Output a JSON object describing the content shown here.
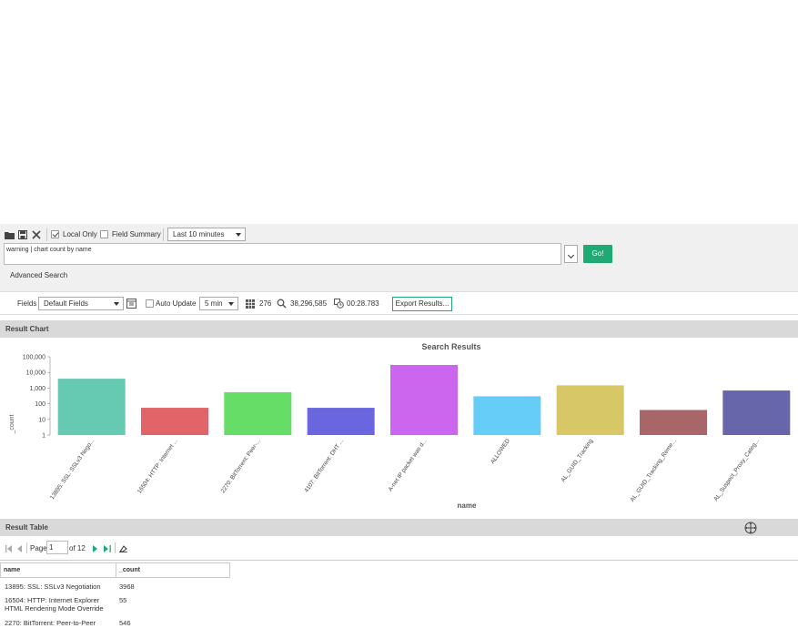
{
  "toolbar": {
    "local_only_label": "Local Only",
    "local_only_checked": true,
    "field_summary_label": "Field Summary",
    "field_summary_checked": false,
    "time_range": "Last 10 minutes"
  },
  "query": {
    "text": "warning | chart count by name",
    "go_label": "Go!",
    "advanced_label": "Advanced Search"
  },
  "fields_row": {
    "fields_label": "Fields",
    "fields_value": "Default Fields",
    "auto_update_label": "Auto Update",
    "auto_update_value": "5 min",
    "result_count": "276",
    "scanned_count": "38,296,585",
    "elapsed": "00:28.783",
    "export_label": "Export Results..."
  },
  "result_chart": {
    "section_title": "Result Chart"
  },
  "chart_data": {
    "type": "bar",
    "title": "Search Results",
    "xlabel": "name",
    "ylabel": "_count",
    "yscale": "log",
    "ylim": [
      1,
      100000
    ],
    "yticks": [
      "1",
      "10",
      "100",
      "1,000",
      "10,000",
      "100,000"
    ],
    "categories": [
      "13895: SSL: SSLv3 Nego...",
      "16504: HTTP: Internet ...",
      "2270: BitTorrent: Peer-...",
      "4107: BitTorrent: DHT ...",
      "A-net IP packet was d...",
      "ALLOWED",
      "AL_GUID_Tracking",
      "AL_GUID_Tracking_Reme...",
      "AL_Suspect_Proxy_Categ..."
    ],
    "values": [
      3968,
      55,
      546,
      55,
      30000,
      300,
      1500,
      40,
      700
    ],
    "colors": [
      "#66c9b1",
      "#e06468",
      "#66dd66",
      "#6a66dd",
      "#cc66ee",
      "#66ccf8",
      "#d8c766",
      "#a86668",
      "#6866aa"
    ]
  },
  "result_table": {
    "section_title": "Result Table",
    "pager": {
      "page_label": "Page",
      "page_value": "1",
      "of_label": "of 12"
    },
    "columns": [
      "name",
      "_count"
    ],
    "rows": [
      {
        "name": "13895: SSL: SSLv3 Negotiation",
        "count": "3968"
      },
      {
        "name": "16504: HTTP: Internet Explorer HTML Rendering Mode Override",
        "count": "55"
      },
      {
        "name": "2270: BitTorrent: Peer-to-Peer",
        "count": "546"
      }
    ]
  },
  "icons": [
    "folder-icon",
    "save-icon",
    "close-icon",
    "calendar-icon",
    "table-icon",
    "search-icon",
    "clock-icon",
    "move-icon",
    "first-page-icon",
    "prev-page-icon",
    "next-page-icon",
    "last-page-icon",
    "clear-icon"
  ]
}
